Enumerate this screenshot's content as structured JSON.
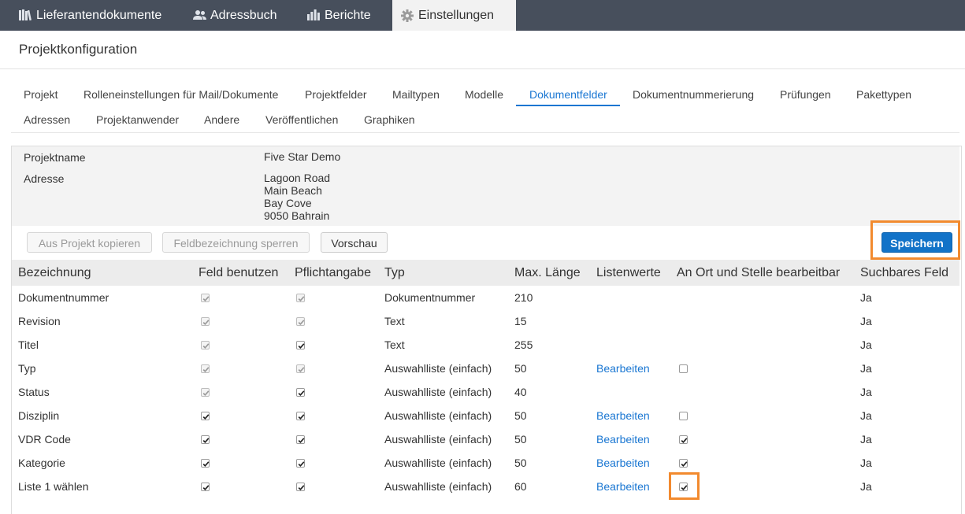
{
  "nav": {
    "tabs": [
      {
        "label": "Lieferantendokumente",
        "icon": "library-icon"
      },
      {
        "label": "Adressbuch",
        "icon": "people-icon"
      },
      {
        "label": "Berichte",
        "icon": "bar-chart-icon"
      },
      {
        "label": "Einstellungen",
        "icon": "gear-icon"
      }
    ],
    "active": "Einstellungen"
  },
  "page_title": "Projektkonfiguration",
  "subtabs": {
    "row1": [
      "Projekt",
      "Rolleneinstellungen für Mail/Dokumente",
      "Projektfelder",
      "Mailtypen",
      "Modelle",
      "Dokumentfelder",
      "Dokumentnummerierung",
      "Prüfungen",
      "Pakettypen"
    ],
    "row2": [
      "Adressen",
      "Projektanwender",
      "Andere",
      "Veröffentlichen",
      "Graphiken"
    ],
    "active": "Dokumentfelder"
  },
  "project": {
    "name_label": "Projektname",
    "name": "Five Star Demo",
    "address_label": "Adresse",
    "address": [
      "Lagoon Road",
      "Main Beach",
      "Bay Cove",
      "9050 Bahrain"
    ]
  },
  "buttons": {
    "copy": "Aus Projekt kopieren",
    "lock": "Feldbezeichnung sperren",
    "preview": "Vorschau",
    "save": "Speichern"
  },
  "table": {
    "headers": [
      "Bezeichnung",
      "Feld benutzen",
      "Pflichtangabe",
      "Typ",
      "Max. Länge",
      "Listenwerte",
      "An Ort und Stelle bearbeitbar",
      "Suchbares Feld"
    ],
    "rows": [
      {
        "name": "Dokumentnummer",
        "use": "checked-disabled",
        "required": "checked-disabled",
        "type": "Dokumentnummer",
        "max": "210",
        "list": "",
        "inplace": "none",
        "search": "Ja"
      },
      {
        "name": "Revision",
        "use": "checked-disabled",
        "required": "checked-disabled",
        "type": "Text",
        "max": "15",
        "list": "",
        "inplace": "none",
        "search": "Ja"
      },
      {
        "name": "Titel",
        "use": "checked-disabled",
        "required": "checked",
        "type": "Text",
        "max": "255",
        "list": "",
        "inplace": "none",
        "search": "Ja"
      },
      {
        "name": "Typ",
        "use": "checked-disabled",
        "required": "checked-disabled",
        "type": "Auswahlliste (einfach)",
        "max": "50",
        "list": "Bearbeiten",
        "inplace": "unchecked",
        "search": "Ja"
      },
      {
        "name": "Status",
        "use": "checked-disabled",
        "required": "checked",
        "type": "Auswahlliste (einfach)",
        "max": "40",
        "list": "",
        "inplace": "none",
        "search": "Ja"
      },
      {
        "name": "Disziplin",
        "use": "checked",
        "required": "checked",
        "type": "Auswahlliste (einfach)",
        "max": "50",
        "list": "Bearbeiten",
        "inplace": "unchecked",
        "search": "Ja"
      },
      {
        "name": "VDR Code",
        "use": "checked",
        "required": "checked",
        "type": "Auswahlliste (einfach)",
        "max": "50",
        "list": "Bearbeiten",
        "inplace": "checked",
        "search": "Ja"
      },
      {
        "name": "Kategorie",
        "use": "checked",
        "required": "checked",
        "type": "Auswahlliste (einfach)",
        "max": "50",
        "list": "Bearbeiten",
        "inplace": "checked",
        "search": "Ja"
      },
      {
        "name": "Liste 1 wählen",
        "use": "checked",
        "required": "checked",
        "type": "Auswahlliste (einfach)",
        "max": "60",
        "list": "Bearbeiten",
        "inplace": "checked",
        "search": "Ja"
      }
    ]
  },
  "colors": {
    "nav_bg": "#474f5c",
    "accent": "#1976d2",
    "primary_btn": "#1273c8",
    "highlight": "#f28a2e"
  }
}
